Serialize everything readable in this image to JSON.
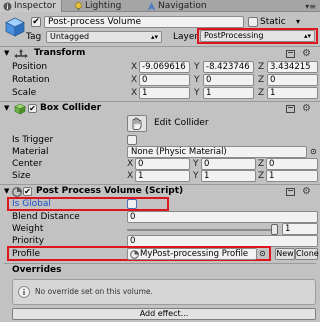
{
  "tabs": [
    {
      "label": "Inspector",
      "icon": "info-icon"
    },
    {
      "label": "Lighting",
      "icon": "lightbulb-icon"
    },
    {
      "label": "Navigation",
      "icon": "navigation-icon"
    }
  ],
  "header": {
    "object_name": "Post-process Volume",
    "static_label": "Static",
    "tag_label": "Tag",
    "tag_value": "Untagged",
    "layer_label": "Layer",
    "layer_value": "PostProcessing",
    "active": true
  },
  "transform": {
    "title": "Transform",
    "rows": [
      {
        "label": "Position",
        "x": "-9.069616",
        "y": "-8.423746",
        "z": "3.434215"
      },
      {
        "label": "Rotation",
        "x": "0",
        "y": "0",
        "z": "0"
      },
      {
        "label": "Scale",
        "x": "1",
        "y": "1",
        "z": "1"
      }
    ],
    "axis_x": "X",
    "axis_y": "Y",
    "axis_z": "Z"
  },
  "box_collider": {
    "title": "Box Collider",
    "edit_collider_label": "Edit Collider",
    "is_trigger_label": "Is Trigger",
    "material_label": "Material",
    "material_value": "None (Physic Material)",
    "center_label": "Center",
    "center": {
      "x": "0",
      "y": "0",
      "z": "0"
    },
    "size_label": "Size",
    "size": {
      "x": "1",
      "y": "1",
      "z": "1"
    }
  },
  "post_process": {
    "title": "Post Process Volume (Script)",
    "is_global_label": "Is Global",
    "blend_distance_label": "Blend Distance",
    "blend_distance_value": "0",
    "weight_label": "Weight",
    "weight_value": "1",
    "weight_fraction": 1,
    "priority_label": "Priority",
    "priority_value": "0",
    "profile_label": "Profile",
    "profile_value": "MyPost-processing Profile",
    "new_label": "New",
    "clone_label": "Clone"
  },
  "overrides": {
    "title": "Overrides",
    "message": "No override set on this volume.",
    "add_effect_label": "Add effect..."
  },
  "colors": {
    "highlight": "#e0141e",
    "global_label": "#1a4fc2"
  }
}
